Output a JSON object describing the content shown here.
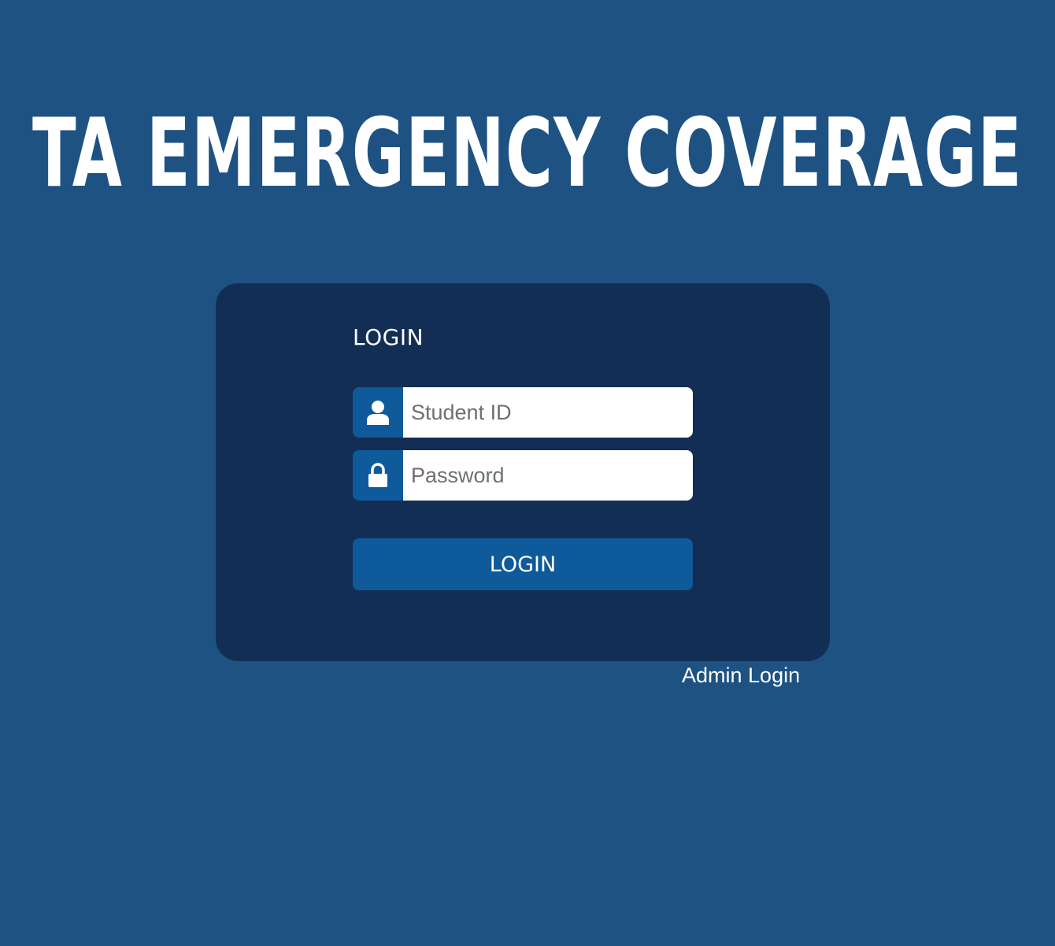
{
  "header": {
    "title": "TA EMERGENCY COVERAGE"
  },
  "login_card": {
    "heading": "LOGIN",
    "student_id": {
      "icon": "user-icon",
      "placeholder": "Student ID",
      "value": ""
    },
    "password": {
      "icon": "lock-icon",
      "placeholder": "Password",
      "value": ""
    },
    "submit_label": "LOGIN"
  },
  "admin_link": {
    "label": "Admin Login"
  },
  "colors": {
    "page_background": "#1e5282",
    "card_background": "#132e54",
    "accent": "#0f5a9b",
    "text": "#ffffff"
  }
}
